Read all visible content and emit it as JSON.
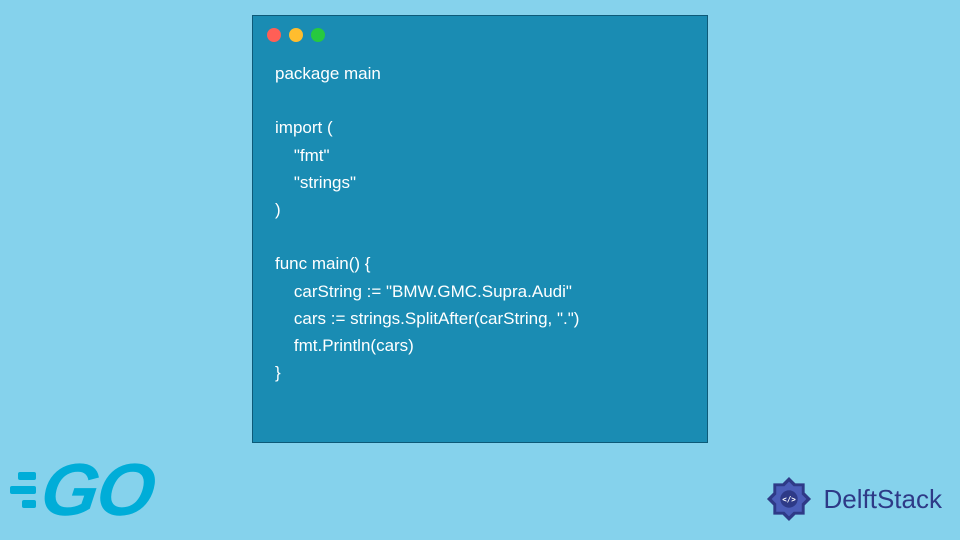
{
  "code": {
    "line1": "package main",
    "line2": "",
    "line3": "import (",
    "line4": "    \"fmt\"",
    "line5": "    \"strings\"",
    "line6": ")",
    "line7": "",
    "line8": "func main() {",
    "line9": "    carString := \"BMW.GMC.Supra.Audi\"",
    "line10": "    cars := strings.SplitAfter(carString, \".\")",
    "line11": "    fmt.Println(cars)",
    "line12": "}"
  },
  "logos": {
    "go": "GO",
    "delft": "DelftStack"
  }
}
